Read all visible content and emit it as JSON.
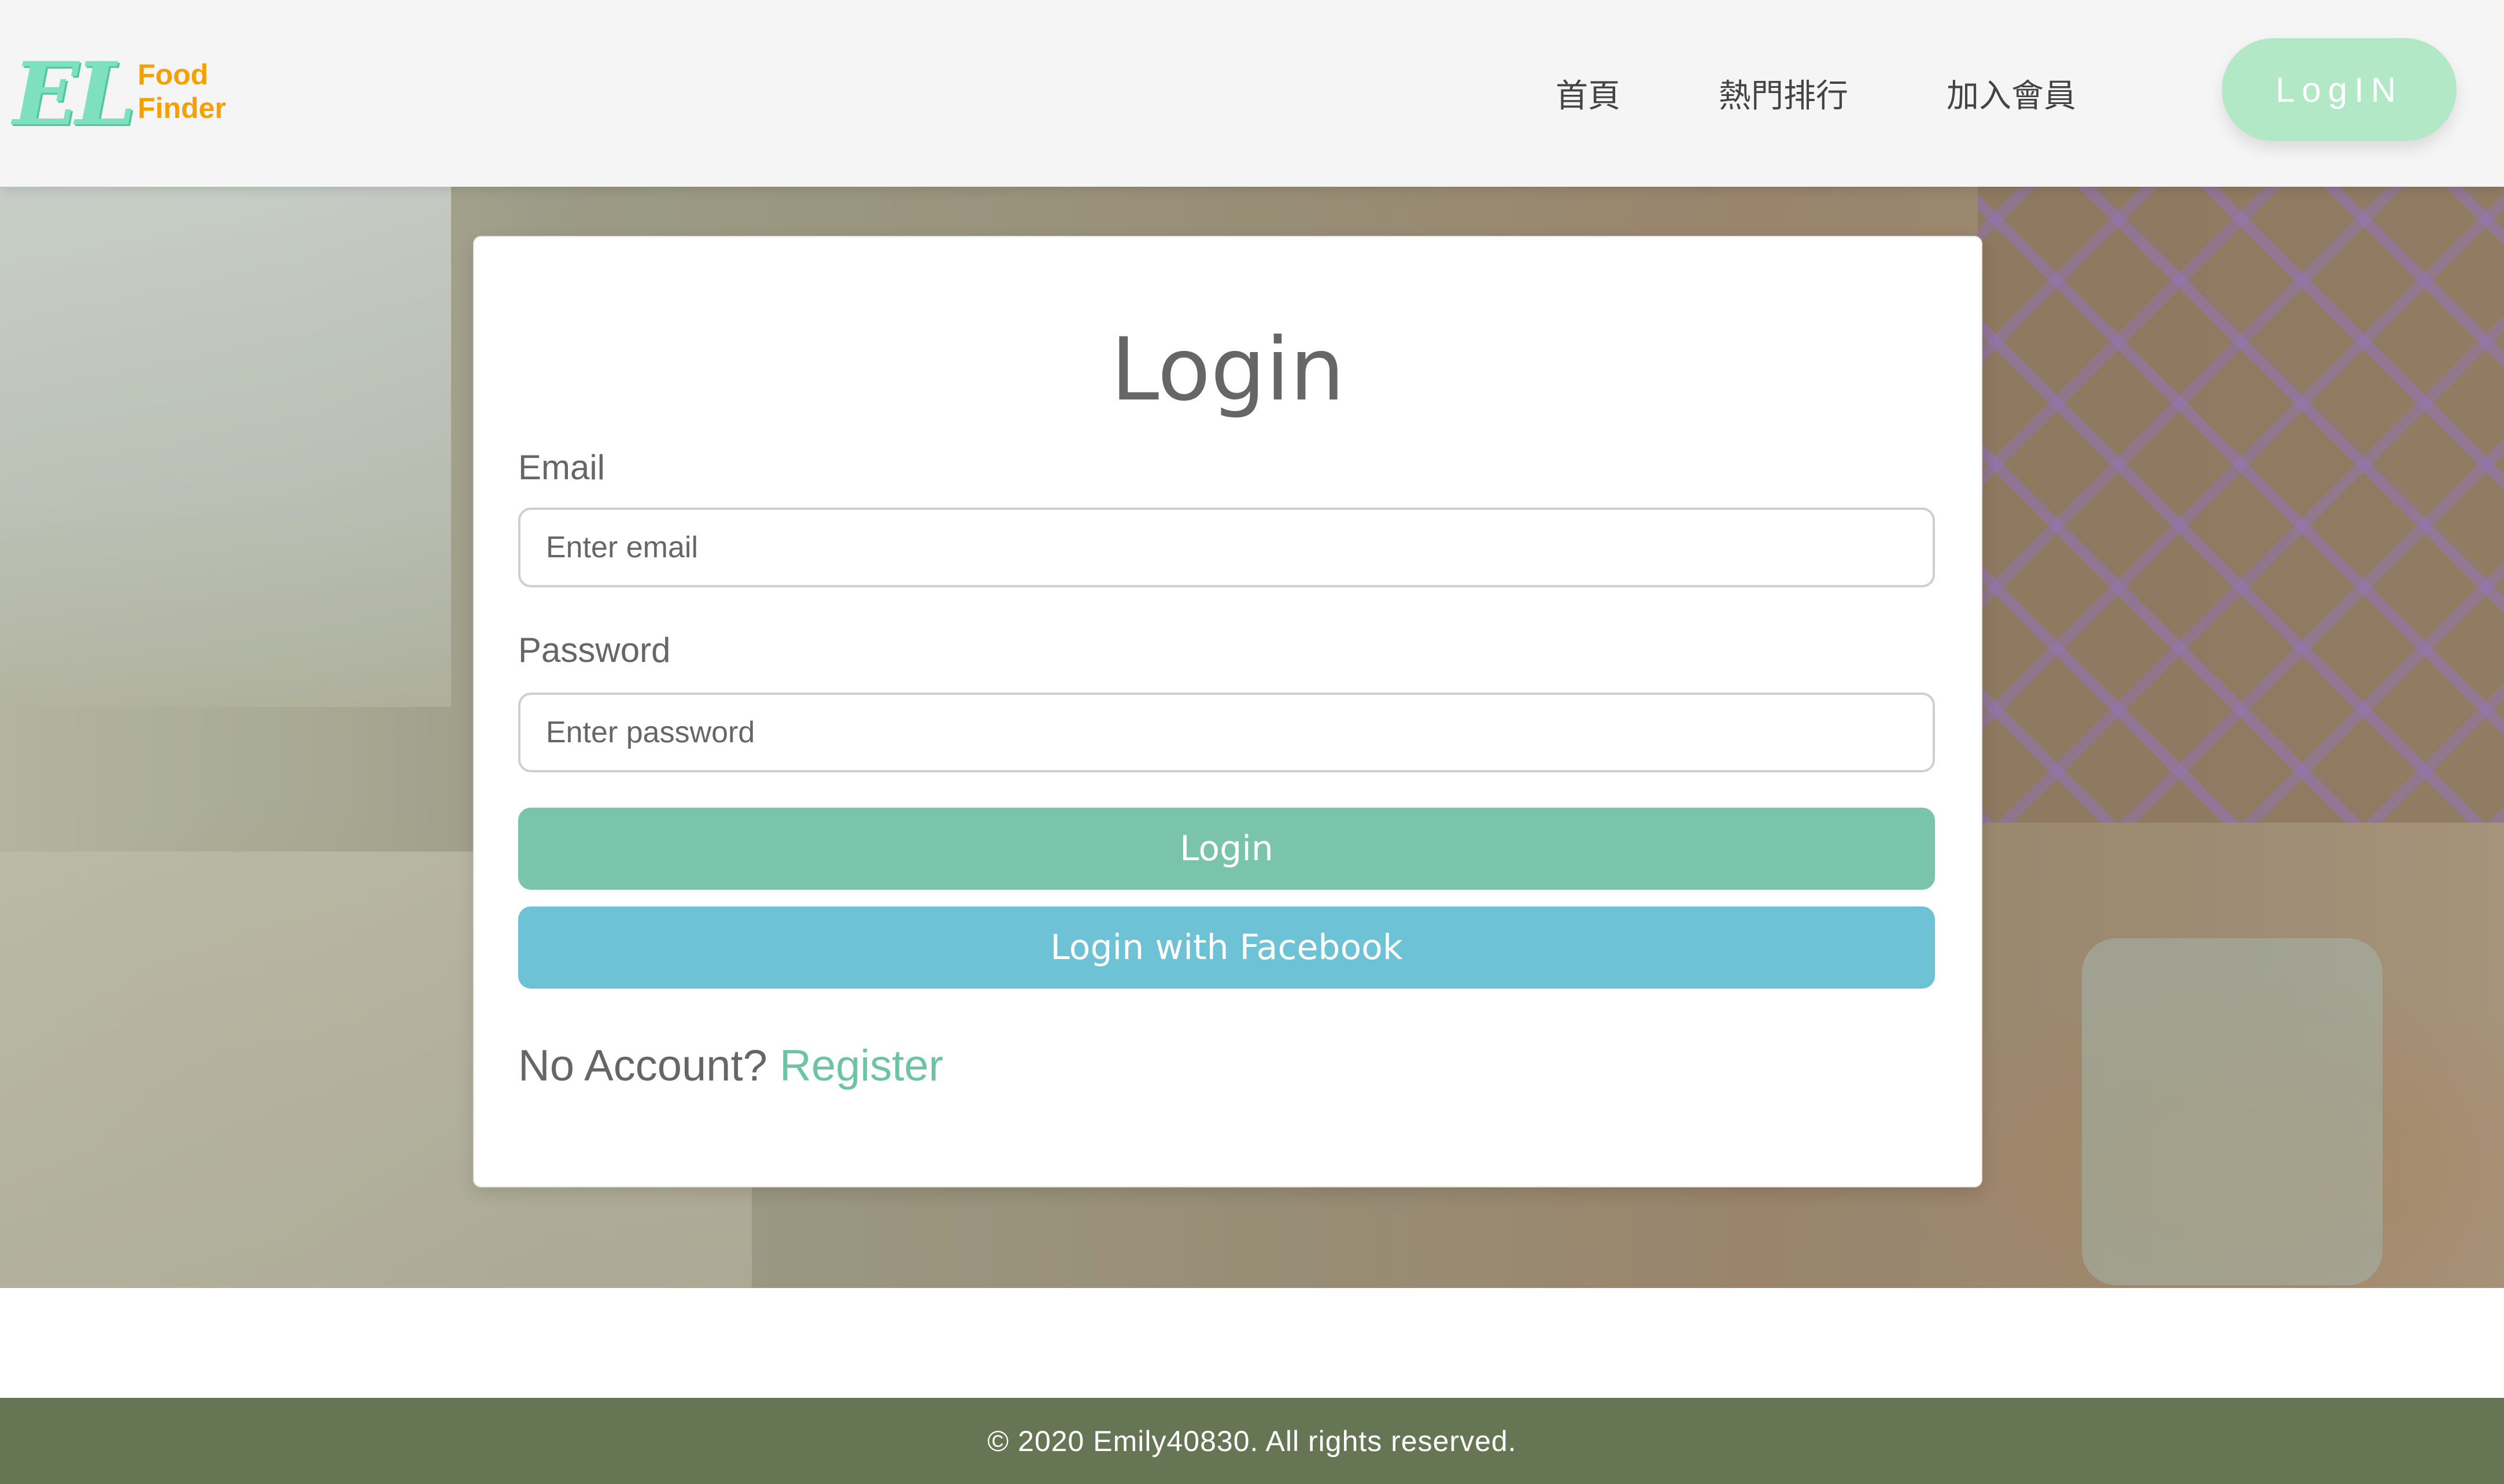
{
  "brand": {
    "mark": "EL",
    "line1": "Food",
    "line2": "Finder"
  },
  "nav": {
    "items": [
      {
        "label": "首頁"
      },
      {
        "label": "熱門排行"
      },
      {
        "label": "加入會員"
      }
    ],
    "login_label": "LogIN"
  },
  "login_form": {
    "title": "Login",
    "email_label": "Email",
    "email_placeholder": "Enter email",
    "email_value": "",
    "password_label": "Password",
    "password_placeholder": "Enter password",
    "password_value": "",
    "submit_label": "Login",
    "facebook_label": "Login with Facebook",
    "no_account_text": "No Account?",
    "register_label": "Register"
  },
  "footer": {
    "text": "© 2020 Emily40830. All rights reserved."
  },
  "colors": {
    "login_button": "#7ac4ac",
    "facebook_button": "#6ec2d6",
    "nav_login_pill": "#b3e8c7",
    "register_link": "#6cc3a5",
    "footer_bg": "#667553",
    "brand_orange": "#f5a000",
    "brand_mint": "#7fe0c0"
  }
}
